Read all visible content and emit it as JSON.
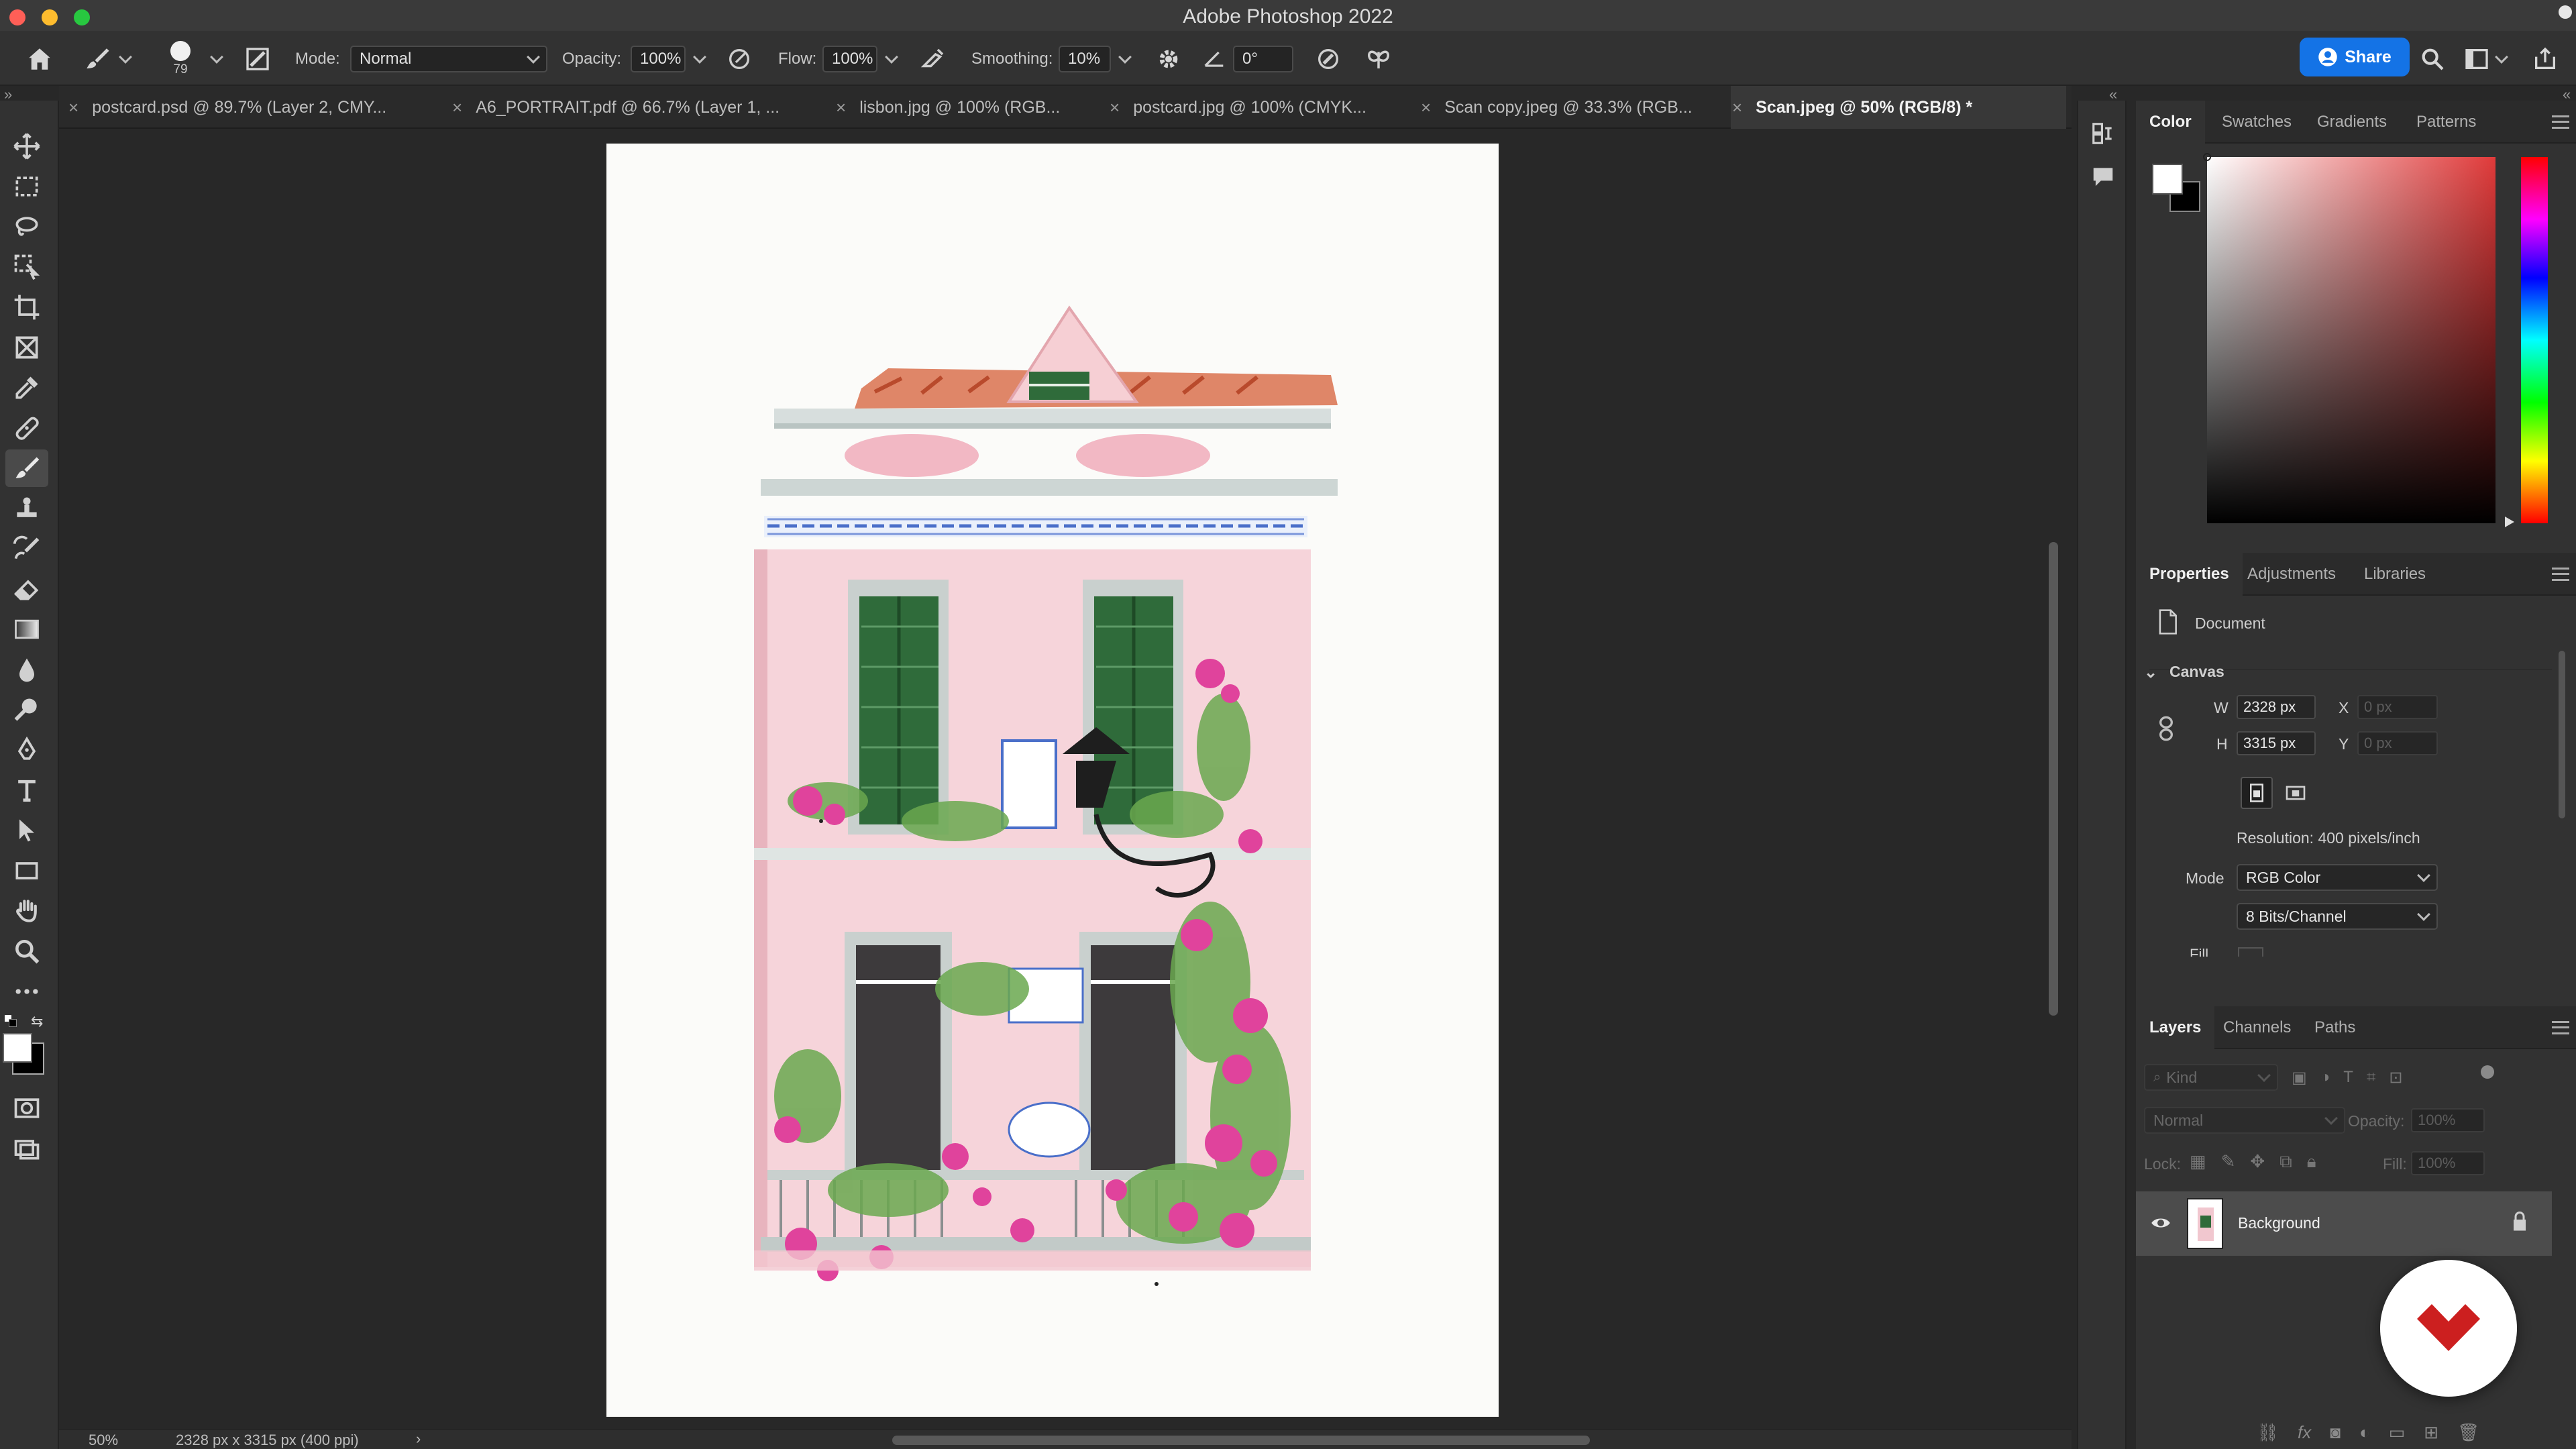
{
  "window": {
    "title": "Adobe Photoshop 2022"
  },
  "options_bar": {
    "brush_size": "79",
    "mode_label": "Mode:",
    "mode_value": "Normal",
    "opacity_label": "Opacity:",
    "opacity_value": "100%",
    "flow_label": "Flow:",
    "flow_value": "100%",
    "smoothing_label": "Smoothing:",
    "smoothing_value": "10%",
    "angle_value": "0°",
    "share_label": "Share"
  },
  "tabs": [
    {
      "label": "postcard.psd @ 89.7% (Layer 2, CMY...",
      "active": false
    },
    {
      "label": "A6_PORTRAIT.pdf @ 66.7% (Layer 1, ...",
      "active": false
    },
    {
      "label": "lisbon.jpg @ 100% (RGB...",
      "active": false
    },
    {
      "label": "postcard.jpg @ 100% (CMYK...",
      "active": false
    },
    {
      "label": "Scan copy.jpeg @ 33.3% (RGB...",
      "active": false
    },
    {
      "label": "Scan.jpeg @ 50% (RGB/8) *",
      "active": true
    }
  ],
  "status": {
    "zoom": "50%",
    "doc_info": "2328 px x 3315 px (400 ppi)"
  },
  "color_panel": {
    "tabs": [
      "Color",
      "Swatches",
      "Gradients",
      "Patterns"
    ],
    "hue_color": "#e03a3a"
  },
  "properties_panel": {
    "tabs": [
      "Properties",
      "Adjustments",
      "Libraries"
    ],
    "document_label": "Document",
    "canvas_label": "Canvas",
    "w_label": "W",
    "w_value": "2328 px",
    "h_label": "H",
    "h_value": "3315 px",
    "x_label": "X",
    "x_placeholder": "0 px",
    "y_label": "Y",
    "y_placeholder": "0 px",
    "resolution": "Resolution: 400 pixels/inch",
    "mode_label": "Mode",
    "mode_value": "RGB Color",
    "bits_value": "8 Bits/Channel",
    "fill_label": "Fill"
  },
  "layers_panel": {
    "tabs": [
      "Layers",
      "Channels",
      "Paths"
    ],
    "kind_placeholder": "Kind",
    "blend_mode": "Normal",
    "opacity_label": "Opacity:",
    "opacity_value": "100%",
    "lock_label": "Lock:",
    "fill_label": "Fill:",
    "fill_value": "100%",
    "layers": [
      {
        "name": "Background",
        "visible": true,
        "locked": true
      }
    ]
  },
  "brand": {
    "accent": "#1473e6",
    "fab_logo_color": "#cc1f1f"
  }
}
